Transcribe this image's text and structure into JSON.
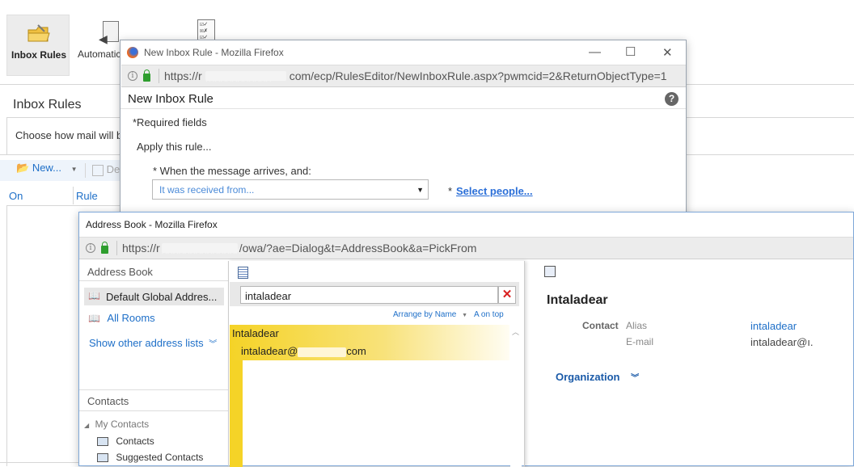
{
  "background": {
    "ribbon": {
      "inbox_rules": "Inbox Rules",
      "automatic": "Automatic"
    },
    "heading": "Inbox Rules",
    "description": "Choose how mail will b",
    "toolbar": {
      "new": "New...",
      "delete": "De"
    },
    "columns": {
      "on": "On",
      "rule": "Rule"
    }
  },
  "rule_window": {
    "title": "New Inbox Rule - Mozilla Firefox",
    "url_prefix": "https://r",
    "url_masked": "mxxxxxxxxxx",
    "url_rest": "com/ecp/RulesEditor/NewInboxRule.aspx?pwmcid=2&ReturnObjectType=1",
    "page_title": "New Inbox Rule",
    "help": "?",
    "required_note": "*Required fields",
    "apply_label": "Apply this rule...",
    "condition_label": "* When the message arrives, and:",
    "condition_value": "It was received from...",
    "select_star": "*",
    "select_people": "Select people..."
  },
  "address_window": {
    "title": "Address Book - Mozilla Firefox",
    "url_prefix": "https://r",
    "url_masked": "xxxxxxxxxxxxxxxx",
    "url_rest": "/owa/?ae=Dialog&t=AddressBook&a=PickFrom",
    "left": {
      "header": "Address Book",
      "items": [
        "Default Global Addres...",
        "All Rooms"
      ],
      "show_other": "Show other address lists",
      "contacts_header": "Contacts",
      "my_contacts": "My Contacts",
      "contact_items": [
        "Contacts",
        "Suggested Contacts"
      ]
    },
    "search": {
      "value": "intaladear",
      "arrange": "Arrange by Name",
      "a_on_top": "A on top"
    },
    "result": {
      "name": "Intaladear",
      "email_prefix": "intaladear@",
      "email_masked": "xxxxxxxx",
      "email_suffix": "com"
    },
    "detail": {
      "name": "Intaladear",
      "contact_label": "Contact",
      "alias_label": "Alias",
      "alias_value": "intaladear",
      "email_label": "E-mail",
      "email_value": "intaladear@ı.",
      "organization": "Organization"
    }
  },
  "colors": {
    "link": "#1e6fc8",
    "highlight_start": "#f5d327",
    "lock_green": "#2e9e2e",
    "close_red": "#d9201f"
  }
}
